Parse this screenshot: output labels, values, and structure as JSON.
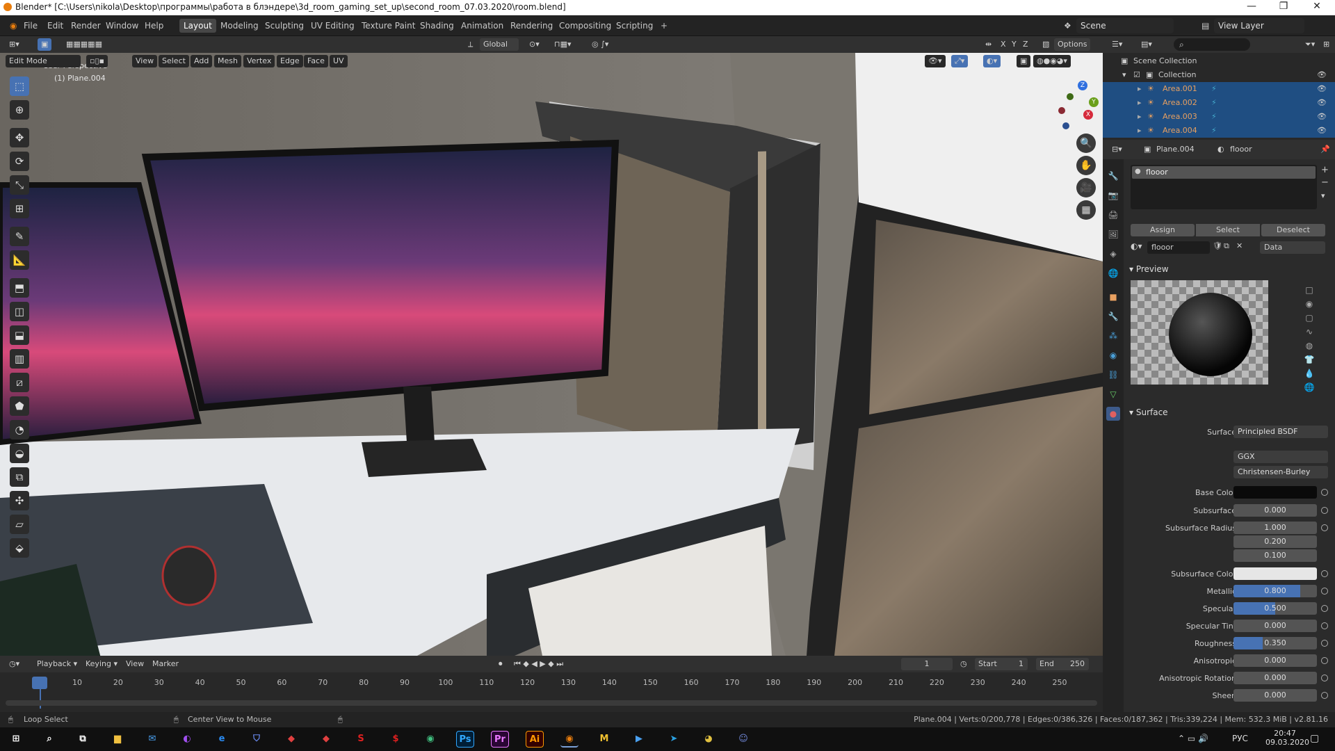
{
  "titlebar": {
    "title": "Blender* [C:\\Users\\nikola\\Desktop\\программы\\работа в блэндере\\3d_room_gaming_set_up\\second_room_07.03.2020\\room.blend]",
    "minimize": "—",
    "maximize": "❐",
    "close": "✕"
  },
  "menu": [
    "File",
    "Edit",
    "Render",
    "Window",
    "Help"
  ],
  "workspaces": [
    "Layout",
    "Modeling",
    "Sculpting",
    "UV Editing",
    "Texture Paint",
    "Shading",
    "Animation",
    "Rendering",
    "Compositing",
    "Scripting"
  ],
  "active_workspace": "Layout",
  "scene": {
    "label": "Scene",
    "view_layer": "View Layer"
  },
  "viewport_header": {
    "transform": "Global",
    "options": "Options",
    "axes": [
      "X",
      "Y",
      "Z"
    ]
  },
  "edit_header": {
    "mode": "Edit Mode",
    "menus": [
      "View",
      "Select",
      "Add",
      "Mesh",
      "Vertex",
      "Edge",
      "Face",
      "UV"
    ]
  },
  "viewport": {
    "perspective": "User Perspective",
    "object": "(1) Plane.004"
  },
  "gizmo": {
    "x": "X",
    "y": "Y",
    "z": "Z"
  },
  "outliner": {
    "root": "Scene Collection",
    "collection": "Collection",
    "items": [
      "Area.001",
      "Area.002",
      "Area.003",
      "Area.004"
    ]
  },
  "properties": {
    "object": "Plane.004",
    "material_name": "flooor",
    "slot": "flooor",
    "buttons": [
      "Assign",
      "Select",
      "Deselect"
    ],
    "datablock": "flooor",
    "link": "Data",
    "preview_label": "Preview",
    "surface_label": "Surface",
    "surface_field_label": "Surface",
    "surface_shader": "Principled BSDF",
    "distribution": "GGX",
    "subsurface_method": "Christensen-Burley",
    "base_color_label": "Base Color",
    "base_color": "#0a0a0a",
    "subsurface_color": "#e6e6e6",
    "rows": [
      {
        "label": "Subsurface",
        "value": "0.000",
        "fill": 0
      },
      {
        "label": "Subsurface Radius",
        "value": "1.000",
        "fill": 0
      },
      {
        "label": "",
        "value": "0.200",
        "fill": 0
      },
      {
        "label": "",
        "value": "0.100",
        "fill": 0
      },
      {
        "label": "Subsurface Color",
        "value": "",
        "fill": 0
      },
      {
        "label": "Metallic",
        "value": "0.800",
        "fill": 0.8
      },
      {
        "label": "Specular",
        "value": "0.500",
        "fill": 0.5
      },
      {
        "label": "Specular Tint",
        "value": "0.000",
        "fill": 0
      },
      {
        "label": "Roughness",
        "value": "0.350",
        "fill": 0.35
      },
      {
        "label": "Anisotropic",
        "value": "0.000",
        "fill": 0
      },
      {
        "label": "Anisotropic Rotation",
        "value": "0.000",
        "fill": 0
      },
      {
        "label": "Sheen",
        "value": "0.000",
        "fill": 0
      }
    ]
  },
  "timeline": {
    "menus": [
      "Playback",
      "Keying",
      "View",
      "Marker"
    ],
    "current_frame": "1",
    "start_label": "Start",
    "start": "1",
    "end_label": "End",
    "end": "250",
    "ticks": [
      "1",
      "10",
      "20",
      "30",
      "40",
      "50",
      "60",
      "70",
      "80",
      "90",
      "100",
      "110",
      "120",
      "130",
      "140",
      "150",
      "160",
      "170",
      "180",
      "190",
      "200",
      "210",
      "220",
      "230",
      "240",
      "250"
    ]
  },
  "status": {
    "left": "Loop Select",
    "middle": "Center View to Mouse",
    "stats": "Plane.004 | Verts:0/200,778 | Edges:0/386,326 | Faces:0/187,362 | Tris:339,224 | Mem: 532.3 MiB | v2.81.16"
  },
  "taskbar": {
    "lang": "РУС",
    "time": "20:47",
    "date": "09.03.2020",
    "apps": [
      "Ps",
      "Pr",
      "Ai",
      "M"
    ]
  }
}
